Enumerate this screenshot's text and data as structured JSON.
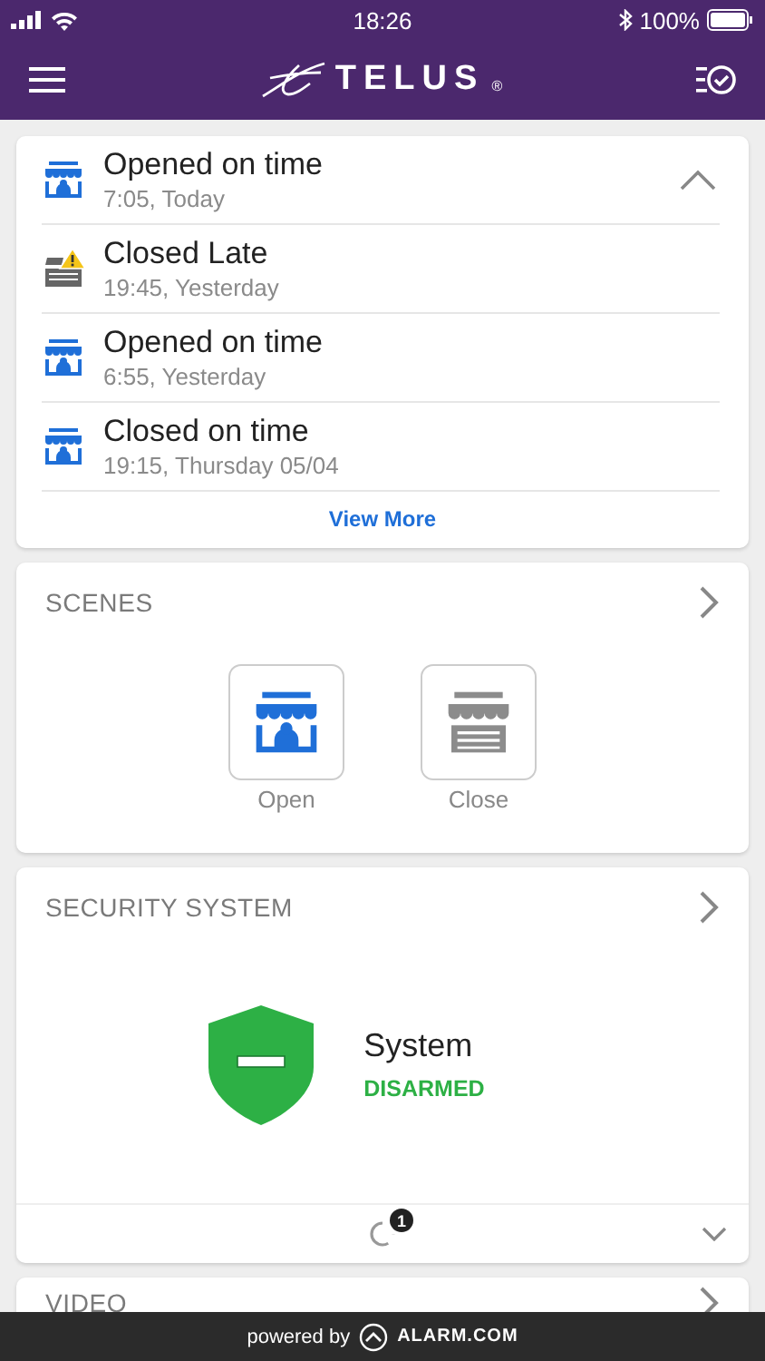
{
  "status_bar": {
    "time": "18:26",
    "battery": "100%"
  },
  "header": {
    "logo": "TELUS",
    "logo_mark": "®"
  },
  "activity": {
    "expanded": true,
    "events": [
      {
        "title": "Opened on time",
        "time": "7:05, Today",
        "kind": "store-open"
      },
      {
        "title": "Closed Late",
        "time": "19:45, Yesterday",
        "kind": "store-alert"
      },
      {
        "title": "Opened on time",
        "time": "6:55, Yesterday",
        "kind": "store-open"
      },
      {
        "title": "Closed on time",
        "time": "19:15, Thursday 05/04",
        "kind": "store-open"
      }
    ],
    "view_more": "View More"
  },
  "scenes": {
    "title": "SCENES",
    "items": [
      {
        "label": "Open",
        "kind": "open"
      },
      {
        "label": "Close",
        "kind": "closed"
      }
    ]
  },
  "security": {
    "title": "SECURITY SYSTEM",
    "name": "System",
    "status": "DISARMED",
    "armed": false,
    "badge": "1"
  },
  "video": {
    "title": "VIDEO"
  },
  "footer": {
    "text": "powered by",
    "brand": "ALARM.COM"
  }
}
